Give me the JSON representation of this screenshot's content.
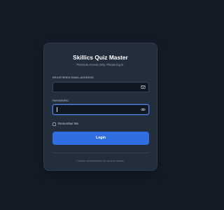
{
  "login": {
    "title": "Skillics Quiz Master",
    "subtitle": "Premium Access Only. Please log in.",
    "email": {
      "label": "REGISTERED EMAIL ADDRESS",
      "value": "",
      "placeholder": "",
      "icon": "envelope-icon"
    },
    "password": {
      "label": "PASSWORD",
      "value": "",
      "placeholder": "",
      "icon": "eye-icon"
    },
    "remember_label": "Remember Me",
    "remember_checked": false,
    "login_label": "Login",
    "footer": "Contact administrator for access issues."
  },
  "colors": {
    "background": "#141b26",
    "card": "#232e3c",
    "input": "#111821",
    "accent": "#2f6de1",
    "focus_border": "#4f7fe0"
  }
}
